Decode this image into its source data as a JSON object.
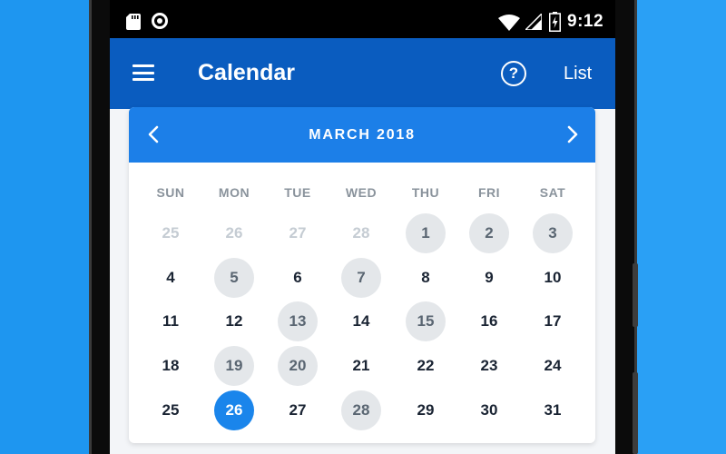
{
  "status_bar": {
    "time": "9:12"
  },
  "app_bar": {
    "title": "Calendar",
    "list_label": "List"
  },
  "calendar": {
    "month_label": "MARCH 2018",
    "weekdays": [
      "SUN",
      "MON",
      "TUE",
      "WED",
      "THU",
      "FRI",
      "SAT"
    ],
    "weeks": [
      [
        {
          "d": "25",
          "s": "other"
        },
        {
          "d": "26",
          "s": "other"
        },
        {
          "d": "27",
          "s": "other"
        },
        {
          "d": "28",
          "s": "other"
        },
        {
          "d": "1",
          "s": "marked"
        },
        {
          "d": "2",
          "s": "marked"
        },
        {
          "d": "3",
          "s": "marked"
        }
      ],
      [
        {
          "d": "4",
          "s": ""
        },
        {
          "d": "5",
          "s": "marked"
        },
        {
          "d": "6",
          "s": ""
        },
        {
          "d": "7",
          "s": "marked"
        },
        {
          "d": "8",
          "s": ""
        },
        {
          "d": "9",
          "s": ""
        },
        {
          "d": "10",
          "s": ""
        }
      ],
      [
        {
          "d": "11",
          "s": ""
        },
        {
          "d": "12",
          "s": ""
        },
        {
          "d": "13",
          "s": "marked"
        },
        {
          "d": "14",
          "s": ""
        },
        {
          "d": "15",
          "s": "marked"
        },
        {
          "d": "16",
          "s": ""
        },
        {
          "d": "17",
          "s": ""
        }
      ],
      [
        {
          "d": "18",
          "s": ""
        },
        {
          "d": "19",
          "s": "marked"
        },
        {
          "d": "20",
          "s": "marked"
        },
        {
          "d": "21",
          "s": ""
        },
        {
          "d": "22",
          "s": ""
        },
        {
          "d": "23",
          "s": ""
        },
        {
          "d": "24",
          "s": ""
        }
      ],
      [
        {
          "d": "25",
          "s": ""
        },
        {
          "d": "26",
          "s": "selected"
        },
        {
          "d": "27",
          "s": ""
        },
        {
          "d": "28",
          "s": "marked"
        },
        {
          "d": "29",
          "s": ""
        },
        {
          "d": "30",
          "s": ""
        },
        {
          "d": "31",
          "s": ""
        }
      ]
    ]
  },
  "colors": {
    "background": "#1e96f0",
    "app_bar": "#0a5cbf",
    "card_header": "#1c7fe8",
    "selected_day": "#1a85eb",
    "marked_day": "#e4e7ea"
  },
  "icons": [
    "sd-card-icon",
    "record-icon",
    "wifi-icon",
    "signal-icon",
    "battery-charging-icon",
    "menu-icon",
    "help-icon",
    "chevron-left-icon",
    "chevron-right-icon"
  ]
}
